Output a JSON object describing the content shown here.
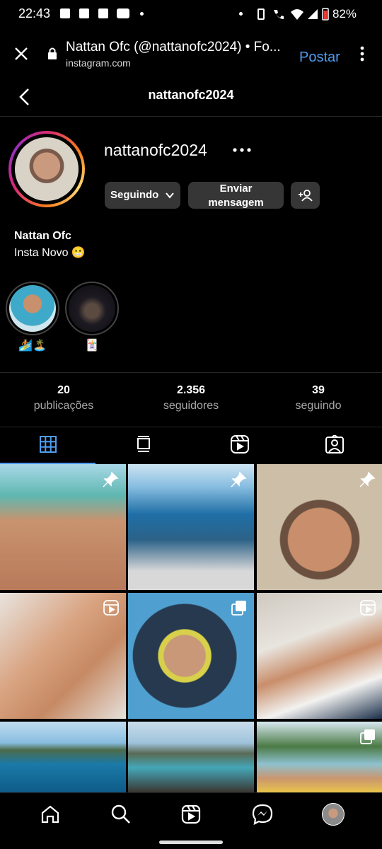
{
  "status_bar": {
    "time": "22:43",
    "battery": "82%"
  },
  "browser": {
    "page_title": "Nattan Ofc (@nattanofc2024) • Fo...",
    "url": "instagram.com",
    "action_label": "Postar"
  },
  "header": {
    "username": "nattanofc2024"
  },
  "profile": {
    "handle": "nattanofc2024",
    "following_button": "Seguindo",
    "message_button": [
      "Enviar",
      "mensagem"
    ],
    "display_name": "Nattan Ofc",
    "bio": "Insta Novo 😬"
  },
  "highlights": [
    {
      "label": "🏄🏝️"
    },
    {
      "label": "🃏"
    }
  ],
  "stats": [
    {
      "value": "20",
      "label": "publicações"
    },
    {
      "value": "2.356",
      "label": "seguidores"
    },
    {
      "value": "39",
      "label": "seguindo"
    }
  ],
  "tabs": [
    {
      "name": "grid-icon",
      "active": true
    },
    {
      "name": "feed-icon",
      "active": false
    },
    {
      "name": "reels-icon",
      "active": false
    },
    {
      "name": "tagged-icon",
      "active": false
    }
  ],
  "posts": [
    {
      "badge": "pin-icon"
    },
    {
      "badge": "pin-icon"
    },
    {
      "badge": "pin-icon"
    },
    {
      "badge": "reel-icon"
    },
    {
      "badge": "carousel-icon"
    },
    {
      "badge": "reel-icon"
    },
    {
      "badge": ""
    },
    {
      "badge": ""
    },
    {
      "badge": "carousel-icon"
    }
  ],
  "colors": {
    "accent": "#4f9df0",
    "active_tab": "#4f9df0",
    "button_bg": "#363636"
  }
}
